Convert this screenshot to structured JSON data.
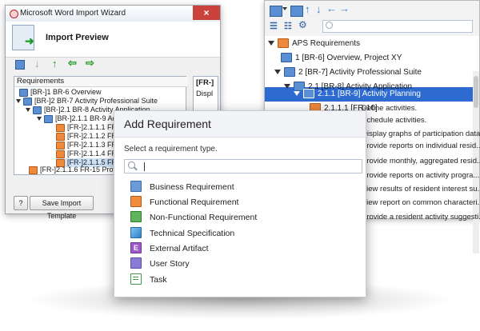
{
  "right_window": {
    "tree": [
      {
        "label": "APS Requirements",
        "icon": "folder-orange-icon",
        "level": 0
      },
      {
        "label": "1 [BR-6] Overview, Project XY",
        "icon": "business-req-icon",
        "level": 1
      },
      {
        "label": "2 [BR-7] Activity Professional Suite",
        "icon": "business-req-icon",
        "level": 1
      },
      {
        "label": "2.1 [BR-8] Activity Application",
        "icon": "business-req-icon",
        "level": 2
      },
      {
        "label": "2.1.1 [BR-9] Activity Planning",
        "icon": "business-req-icon",
        "level": 3,
        "selected": true
      },
      {
        "label": "2.1.1.1 [FR-10]",
        "icon": "functional-req-icon",
        "level": 4
      }
    ],
    "requirements_text": [
      "Define activities.",
      "Schedule activities.",
      "Display graphs of participation data.",
      "Provide reports on individual resid...",
      "Provide monthly, aggregated resid...",
      "Provide reports on activity progra...",
      "View results of resident interest su...",
      "View report on common characteri...",
      "Provide a resident activity suggesti..."
    ]
  },
  "left_window": {
    "title": "Microsoft Word Import Wizard",
    "close_symbol": "×",
    "header_title": "Import Preview",
    "panel_header": "Requirements",
    "tree": [
      {
        "label": "[BR-]1 BR-6 Overview",
        "icon": "business-req-icon"
      },
      {
        "label": "[BR-]2 BR-7 Activity Professional Suite",
        "icon": "business-req-icon"
      },
      {
        "label": "[BR-]2.1 BR-8 Activity Application",
        "icon": "business-req-icon"
      },
      {
        "label": "[BR-]2.1.1 BR-9 Acti",
        "icon": "business-req-icon"
      },
      {
        "label": "[FR-]2.1.1.1 FR-",
        "icon": "functional-req-icon"
      },
      {
        "label": "[FR-]2.1.1.2 FR-",
        "icon": "functional-req-icon"
      },
      {
        "label": "[FR-]2.1.1.3 FR-",
        "icon": "functional-req-icon"
      },
      {
        "label": "[FR-]2.1.1.4 FR-",
        "icon": "functional-req-icon"
      },
      {
        "label": "[FR-]2.1.1.5 FR-",
        "icon": "functional-req-icon",
        "selected": true
      },
      {
        "label": "[FR-]2.1.1.6 FR-15 Provide r",
        "icon": "functional-req-icon"
      }
    ],
    "side_header": "[FR-]",
    "side_text": "Displ",
    "help_button": "?",
    "save_template_button": "Save Import Template"
  },
  "dialog": {
    "title": "Add Requirement",
    "prompt": "Select a requirement type.",
    "search_value": "",
    "options": [
      {
        "label": "Business Requirement",
        "icon": "business-requirement-icon"
      },
      {
        "label": "Functional Requirement",
        "icon": "functional-requirement-icon"
      },
      {
        "label": "Non-Functional Requirement",
        "icon": "non-functional-requirement-icon"
      },
      {
        "label": "Technical Specification",
        "icon": "technical-specification-icon"
      },
      {
        "label": "External Artifact",
        "icon": "external-artifact-icon"
      },
      {
        "label": "User Story",
        "icon": "user-story-icon"
      },
      {
        "label": "Task",
        "icon": "task-icon"
      }
    ],
    "external_artifact_letter": "E"
  }
}
